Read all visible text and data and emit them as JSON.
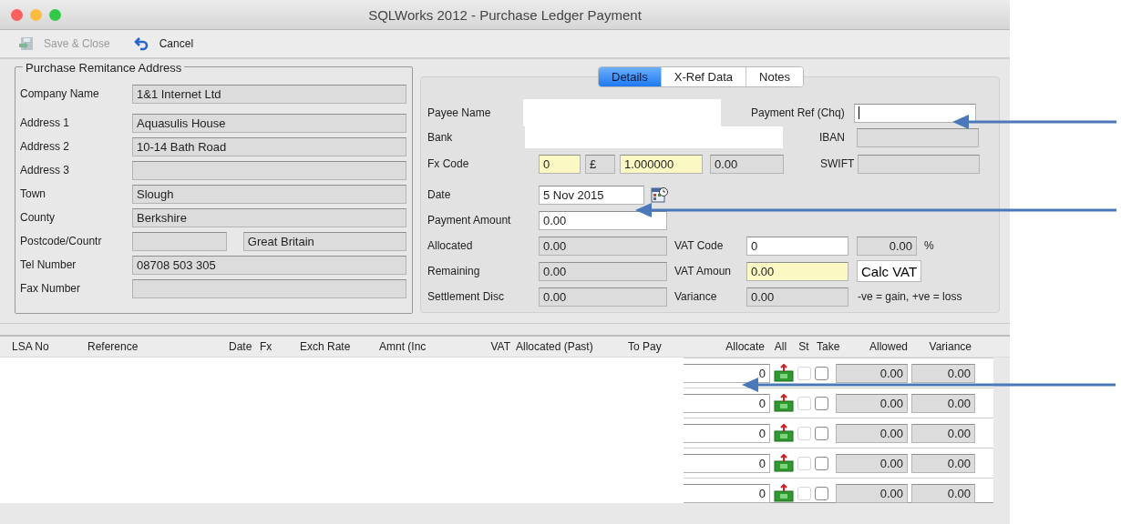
{
  "window": {
    "title": "SQLWorks 2012 - Purchase Ledger Payment"
  },
  "toolbar": [
    {
      "label": "Save & Close",
      "disabled": true
    },
    {
      "label": "Cancel",
      "disabled": false
    }
  ],
  "address": {
    "title": "Purchase Remitance Address",
    "fields": [
      {
        "label": "Company Name",
        "value": "1&1 Internet Ltd"
      },
      {
        "label": "Address 1",
        "value": "Aquasulis House"
      },
      {
        "label": "Address 2",
        "value": "10-14 Bath Road"
      },
      {
        "label": "Address 3"
      },
      {
        "label": "Town",
        "value": "Slough"
      },
      {
        "label": "County",
        "value": "Berkshire"
      },
      {
        "label": "Postcode/Countr",
        "country": "Great Britain"
      },
      {
        "label": "Tel Number",
        "value": "08708 503 305"
      },
      {
        "label": "Fax Number"
      }
    ]
  },
  "tabs": [
    {
      "label": "Details",
      "selected": true
    },
    {
      "label": "X-Ref Data",
      "selected": false
    },
    {
      "label": "Notes",
      "selected": false
    }
  ],
  "details": {
    "payee_name": {
      "label": "Payee Name"
    },
    "payment_ref": {
      "label": "Payment Ref (Chq)",
      "kind": "editable",
      "focused": true
    },
    "bank": {
      "label": "Bank"
    },
    "iban": {
      "label": "IBAN",
      "kind": "readonly"
    },
    "fx_code": {
      "label": "Fx Code",
      "fields": [
        {
          "value": "0",
          "kind": "highlighted"
        },
        {
          "value": "£",
          "kind": "readonly"
        },
        {
          "value": "1.000000",
          "kind": "highlighted"
        },
        {
          "value": "0.00",
          "kind": "readonly"
        }
      ]
    },
    "swift": {
      "label": "SWIFT",
      "kind": "readonly"
    },
    "date": {
      "label": "Date",
      "value": "5 Nov 2015",
      "kind": "editable"
    },
    "payment_amount": {
      "label": "Payment Amount",
      "value": "0.00",
      "kind": "editable"
    },
    "allocated": {
      "label": "Allocated",
      "value": "0.00",
      "kind": "readonly"
    },
    "vat_code": {
      "label": "VAT Code",
      "value": "0",
      "kind": "editable",
      "rate": "0.00",
      "unit": "%"
    },
    "remaining": {
      "label": "Remaining",
      "value": "0.00",
      "kind": "readonly"
    },
    "vat_amount": {
      "label": "VAT Amoun",
      "value": "0.00",
      "kind": "highlighted"
    },
    "calc_vat": "Calc VAT",
    "settlement_disc": {
      "label": "Settlement Disc",
      "value": "0.00",
      "kind": "readonly"
    },
    "variance": {
      "label": "Variance",
      "value": "0.00",
      "kind": "readonly"
    },
    "variance_note": "-ve = gain, +ve = loss"
  },
  "grid": {
    "columns": [
      "LSA No",
      "Reference",
      "Date",
      "Fx",
      "Exch Rate",
      "Amnt (Inc",
      "VAT",
      "Allocated (Past)",
      "To Pay",
      "Allocate",
      "All",
      "St",
      "Take",
      "Allowed",
      "Variance"
    ],
    "rows": [
      {
        "allocate": "0",
        "st": false,
        "take": false,
        "allowed": "0.00",
        "variance": "0.00"
      },
      {
        "allocate": "0",
        "st": false,
        "take": false,
        "allowed": "0.00",
        "variance": "0.00"
      },
      {
        "allocate": "0",
        "st": false,
        "take": false,
        "allowed": "0.00",
        "variance": "0.00"
      },
      {
        "allocate": "0",
        "st": false,
        "take": false,
        "allowed": "0.00",
        "variance": "0.00"
      },
      {
        "allocate": "0",
        "st": false,
        "take": false,
        "allowed": "0.00",
        "variance": "0.00"
      }
    ]
  }
}
